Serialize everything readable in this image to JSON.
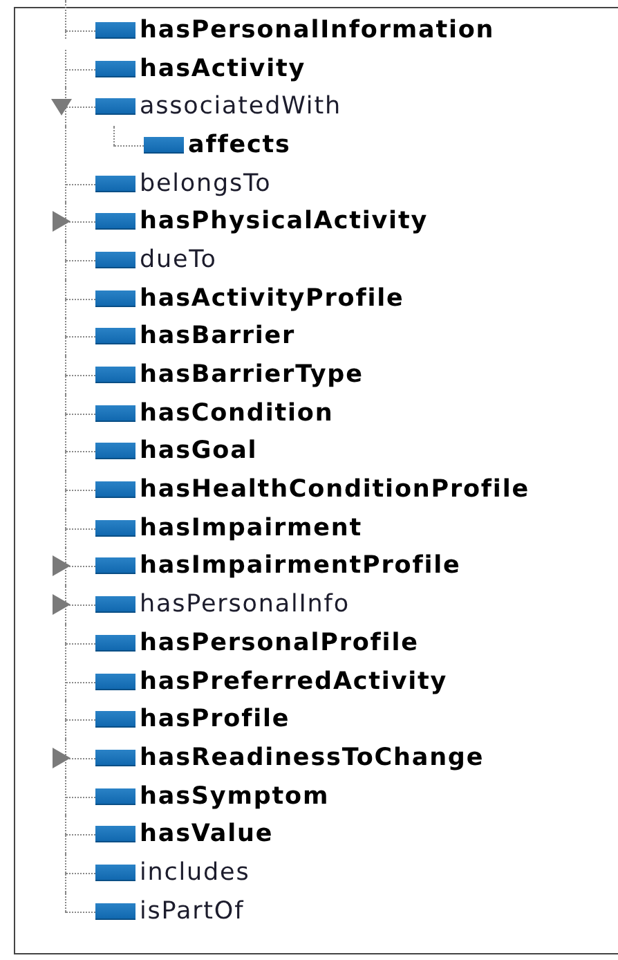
{
  "property_tree": {
    "items": [
      {
        "label": "hasPersonalInformation",
        "emphasized": true,
        "kind": "leaf"
      },
      {
        "label": "hasActivity",
        "emphasized": true,
        "kind": "leaf"
      },
      {
        "label": "associatedWith",
        "emphasized": false,
        "kind": "branch",
        "expanded": true,
        "children": [
          {
            "label": "affects",
            "emphasized": true,
            "kind": "leaf"
          }
        ]
      },
      {
        "label": "belongsTo",
        "emphasized": false,
        "kind": "leaf"
      },
      {
        "label": "hasPhysicalActivity",
        "emphasized": true,
        "kind": "branch",
        "expanded": false
      },
      {
        "label": "dueTo",
        "emphasized": false,
        "kind": "leaf"
      },
      {
        "label": "hasActivityProfile",
        "emphasized": true,
        "kind": "leaf"
      },
      {
        "label": "hasBarrier",
        "emphasized": true,
        "kind": "leaf"
      },
      {
        "label": "hasBarrierType",
        "emphasized": true,
        "kind": "leaf"
      },
      {
        "label": "hasCondition",
        "emphasized": true,
        "kind": "leaf"
      },
      {
        "label": "hasGoal",
        "emphasized": true,
        "kind": "leaf"
      },
      {
        "label": "hasHealthConditionProfile",
        "emphasized": true,
        "kind": "leaf"
      },
      {
        "label": "hasImpairment",
        "emphasized": true,
        "kind": "leaf"
      },
      {
        "label": "hasImpairmentProfile",
        "emphasized": true,
        "kind": "branch",
        "expanded": false
      },
      {
        "label": "hasPersonalInfo",
        "emphasized": false,
        "kind": "branch",
        "expanded": false
      },
      {
        "label": "hasPersonalProfile",
        "emphasized": true,
        "kind": "leaf"
      },
      {
        "label": "hasPreferredActivity",
        "emphasized": true,
        "kind": "leaf"
      },
      {
        "label": "hasProfile",
        "emphasized": true,
        "kind": "leaf"
      },
      {
        "label": "hasReadinessToChange",
        "emphasized": true,
        "kind": "branch",
        "expanded": false
      },
      {
        "label": "hasSymptom",
        "emphasized": true,
        "kind": "leaf"
      },
      {
        "label": "hasValue",
        "emphasized": true,
        "kind": "leaf"
      },
      {
        "label": "includes",
        "emphasized": false,
        "kind": "leaf"
      },
      {
        "label": "isPartOf",
        "emphasized": false,
        "kind": "leaf"
      }
    ]
  }
}
